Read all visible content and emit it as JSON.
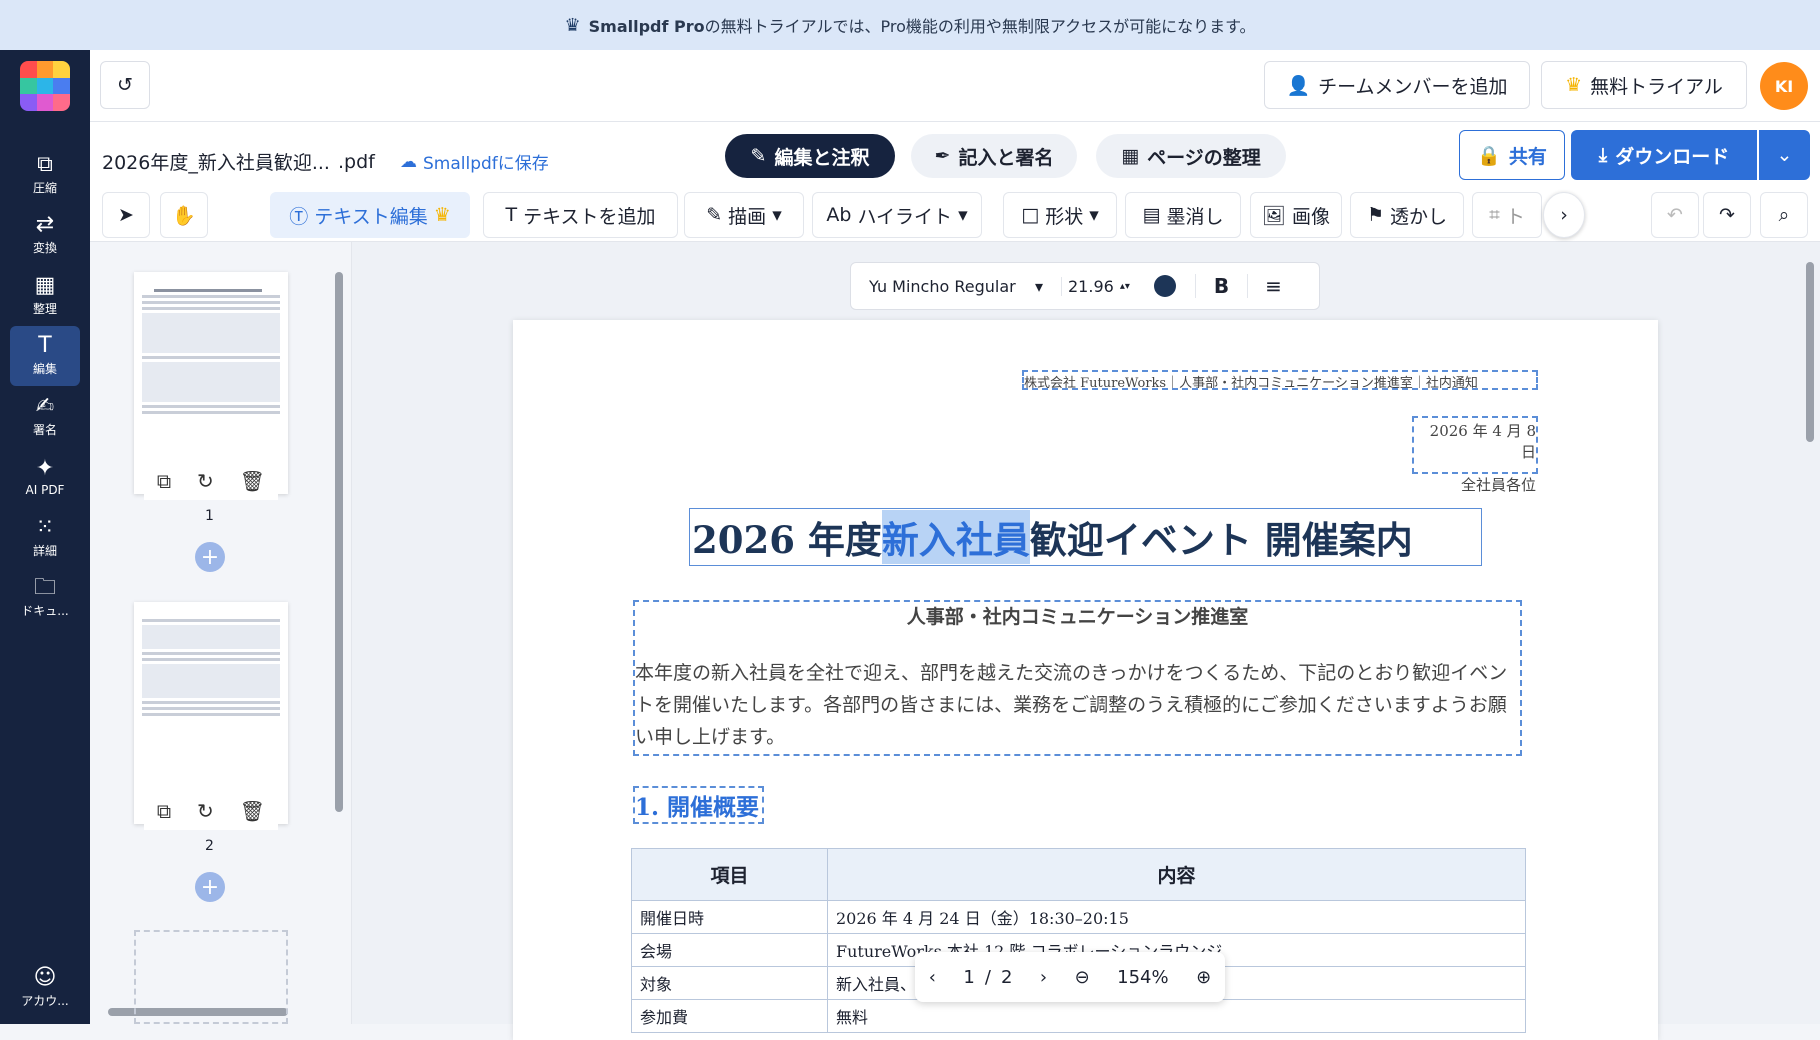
{
  "banner": {
    "brand": "Smallpdf Pro",
    "text": "の無料トライアルでは、Pro機能の利用や無制限アクセスが可能になります。"
  },
  "nav": {
    "items": [
      {
        "label": "圧縮",
        "icon": "compress-icon"
      },
      {
        "label": "変換",
        "icon": "convert-icon"
      },
      {
        "label": "整理",
        "icon": "organize-icon"
      },
      {
        "label": "編集",
        "icon": "edit-icon"
      },
      {
        "label": "署名",
        "icon": "sign-icon"
      },
      {
        "label": "AI PDF",
        "icon": "ai-icon"
      },
      {
        "label": "詳細",
        "icon": "grid-icon"
      },
      {
        "label": "ドキュ...",
        "icon": "folder-icon"
      }
    ],
    "account": "アカウ..."
  },
  "top": {
    "add_member": "チームメンバーを追加",
    "trial": "無料トライアル",
    "avatar": "KI"
  },
  "doc": {
    "filename": "2026年度_新入社員歓迎...",
    "ext": ".pdf",
    "save": "Smallpdfに保存"
  },
  "tabs": {
    "edit": "編集と注釈",
    "fill": "記入と署名",
    "pages": "ページの整理"
  },
  "actions": {
    "share": "共有",
    "download": "ダウンロード"
  },
  "tools": {
    "text_edit": "テキスト編集",
    "add_text": "テキストを追加",
    "draw": "描画",
    "highlight": "ハイライト",
    "shape": "形状",
    "redact": "墨消し",
    "image": "画像",
    "watermark": "透かし",
    "crop": "ト"
  },
  "format": {
    "font": "Yu Mincho Regular",
    "size": "21.96",
    "bold": "B"
  },
  "thumbs": {
    "p1": "1",
    "p2": "2"
  },
  "page": {
    "header": "株式会社 FutureWorks｜人事部・社内コミュニケーション推進室｜社内通知",
    "date": "2026 年 4 月 8 日",
    "to": "全社員各位",
    "title_pre": "2026 年度 ",
    "title_sel": "新入社員",
    "title_post": "歓迎イベント 開催案内",
    "dept": "人事部・社内コミュニケーション推進室",
    "body": "本年度の新入社員を全社で迎え、部門を越えた交流のきっかけをつくるため、下記のとおり歓迎イベントを開催いたします。各部門の皆さまには、業務をご調整のうえ積極的にご参加くださいますようお願い申し上げます。",
    "section1": "1. 開催概要"
  },
  "table": {
    "headers": [
      "項目",
      "内容"
    ],
    "rows": [
      [
        "開催日時",
        "2026 年 4 月 24 日（金）18:30–20:15"
      ],
      [
        "会場",
        "FutureWorks 本社 12 階 コラボレーションラウンジ"
      ],
      [
        "対象",
        "新入社員、"
      ],
      [
        "参加費",
        "無料"
      ]
    ]
  },
  "pager": {
    "current": "1",
    "sep": "/",
    "total": "2",
    "zoom": "154%"
  }
}
